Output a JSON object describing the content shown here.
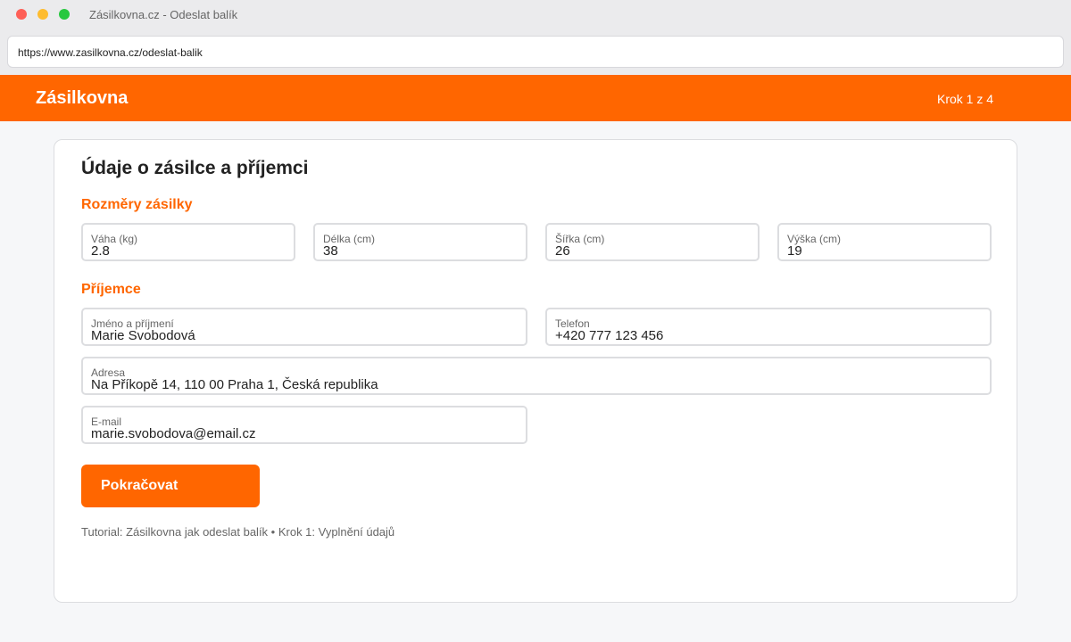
{
  "window": {
    "title": "Zásilkovna.cz - Odeslat balík"
  },
  "browser": {
    "url": "https://www.zasilkovna.cz/odeslat-balik"
  },
  "header": {
    "logo": "Zásilkovna",
    "step": "Krok 1 z 4"
  },
  "form": {
    "title": "Údaje o zásilce a příjemci",
    "dimensions_section": "Rozměry zásilky",
    "weight": {
      "label": "Váha (kg)",
      "value": "2.8"
    },
    "length": {
      "label": "Délka (cm)",
      "value": "38"
    },
    "width": {
      "label": "Šířka (cm)",
      "value": "26"
    },
    "height": {
      "label": "Výška (cm)",
      "value": "19"
    },
    "recipient_section": "Příjemce",
    "name": {
      "label": "Jméno a příjmení",
      "value": "Marie Svobodová"
    },
    "phone": {
      "label": "Telefon",
      "value": "+420 777 123 456"
    },
    "address": {
      "label": "Adresa",
      "value": "Na Příkopě 14, 110 00 Praha 1, Česká republika"
    },
    "email": {
      "label": "E-mail",
      "value": "marie.svobodova@email.cz"
    },
    "continue_label": "Pokračovat",
    "footer_note": "Tutorial: Zásilkovna jak odeslat balík • Krok 1: Vyplnění údajů"
  },
  "colors": {
    "brand": "#ff6600",
    "border": "#dcdde0",
    "background": "#f6f7f9"
  }
}
